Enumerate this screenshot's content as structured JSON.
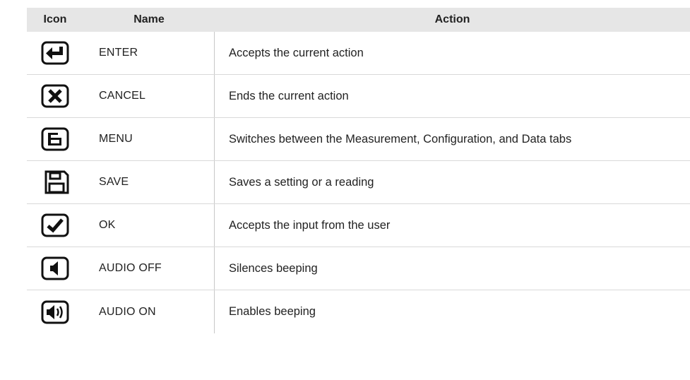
{
  "table": {
    "headers": {
      "icon": "Icon",
      "name": "Name",
      "action": "Action"
    },
    "rows": [
      {
        "icon": "enter-icon",
        "name": "ENTER",
        "action": "Accepts the current action"
      },
      {
        "icon": "cancel-icon",
        "name": "CANCEL",
        "action": "Ends the current action"
      },
      {
        "icon": "menu-icon",
        "name": "MENU",
        "action": "Switches between the Measurement, Configuration, and Data tabs"
      },
      {
        "icon": "save-icon",
        "name": "SAVE",
        "action": "Saves a setting or a reading"
      },
      {
        "icon": "ok-icon",
        "name": "OK",
        "action": "Accepts the input from the user"
      },
      {
        "icon": "audio-off-icon",
        "name": "AUDIO OFF",
        "action": "Silences beeping"
      },
      {
        "icon": "audio-on-icon",
        "name": "AUDIO ON",
        "action": "Enables beeping"
      }
    ]
  }
}
